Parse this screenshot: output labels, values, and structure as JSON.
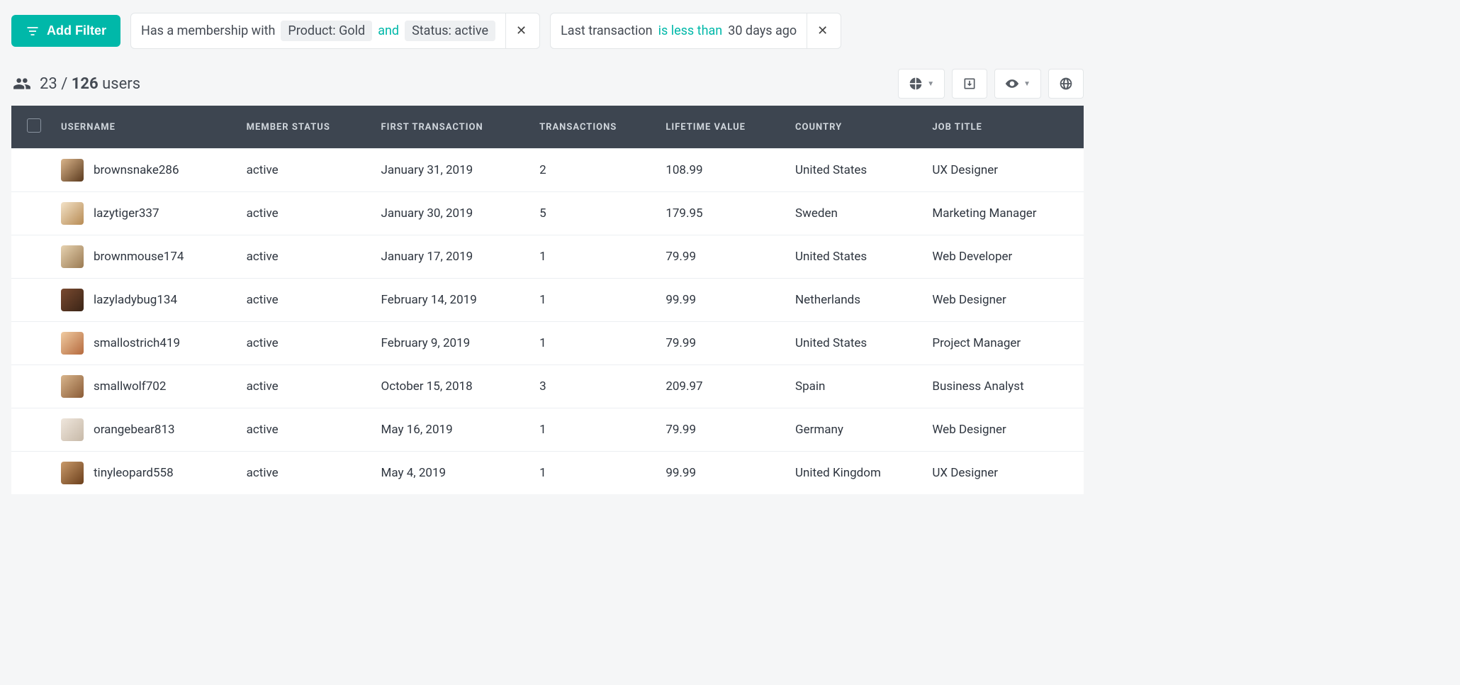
{
  "filters": {
    "add_label": "Add Filter",
    "chips": [
      {
        "parts": [
          {
            "type": "text",
            "value": "Has a membership with"
          },
          {
            "type": "tag",
            "value": "Product: Gold"
          },
          {
            "type": "op",
            "value": "and"
          },
          {
            "type": "tag",
            "value": "Status: active"
          }
        ]
      },
      {
        "parts": [
          {
            "type": "text",
            "value": "Last transaction"
          },
          {
            "type": "op",
            "value": "is less than"
          },
          {
            "type": "text",
            "value": "30 days ago"
          }
        ]
      }
    ]
  },
  "count": {
    "shown": "23",
    "sep": "/",
    "total": "126",
    "unit": "users"
  },
  "toolbar_icons": [
    "chart",
    "export",
    "eye",
    "globe"
  ],
  "table": {
    "headers": [
      "USERNAME",
      "MEMBER STATUS",
      "FIRST TRANSACTION",
      "TRANSACTIONS",
      "LIFETIME VALUE",
      "COUNTRY",
      "JOB TITLE"
    ],
    "rows": [
      {
        "username": "brownsnake286",
        "status": "active",
        "first": "January 31, 2019",
        "tx": "2",
        "lv": "108.99",
        "country": "United States",
        "job": "UX Designer"
      },
      {
        "username": "lazytiger337",
        "status": "active",
        "first": "January 30, 2019",
        "tx": "5",
        "lv": "179.95",
        "country": "Sweden",
        "job": "Marketing Manager"
      },
      {
        "username": "brownmouse174",
        "status": "active",
        "first": "January 17, 2019",
        "tx": "1",
        "lv": "79.99",
        "country": "United States",
        "job": "Web Developer"
      },
      {
        "username": "lazyladybug134",
        "status": "active",
        "first": "February 14, 2019",
        "tx": "1",
        "lv": "99.99",
        "country": "Netherlands",
        "job": "Web Designer"
      },
      {
        "username": "smallostrich419",
        "status": "active",
        "first": "February 9, 2019",
        "tx": "1",
        "lv": "79.99",
        "country": "United States",
        "job": "Project Manager"
      },
      {
        "username": "smallwolf702",
        "status": "active",
        "first": "October 15, 2018",
        "tx": "3",
        "lv": "209.97",
        "country": "Spain",
        "job": "Business Analyst"
      },
      {
        "username": "orangebear813",
        "status": "active",
        "first": "May 16, 2019",
        "tx": "1",
        "lv": "79.99",
        "country": "Germany",
        "job": "Web Designer"
      },
      {
        "username": "tinyleopard558",
        "status": "active",
        "first": "May 4, 2019",
        "tx": "1",
        "lv": "99.99",
        "country": "United Kingdom",
        "job": "UX Designer"
      }
    ]
  }
}
